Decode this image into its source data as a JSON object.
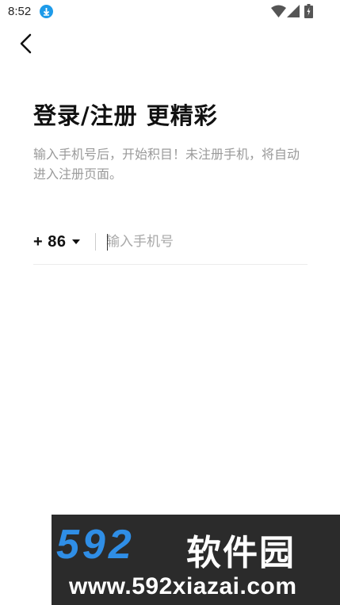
{
  "status_bar": {
    "time": "8:52",
    "icons": [
      "download-icon",
      "wifi-icon",
      "signal-icon",
      "battery-icon"
    ],
    "download_color": "#1e9be9"
  },
  "header": {
    "back_icon": "chevron-left-icon"
  },
  "login": {
    "title": "登录/注册 更精彩",
    "subtitle": "输入手机号后，开始积目！未注册手机，将自动进入注册页面。",
    "country_code": "+ 86",
    "phone_placeholder": "输入手机号",
    "phone_value": ""
  },
  "watermark": {
    "numbers": "592",
    "brand": "软件园",
    "url": "www.592xiazai.com",
    "accent": "#2f8ee6"
  }
}
